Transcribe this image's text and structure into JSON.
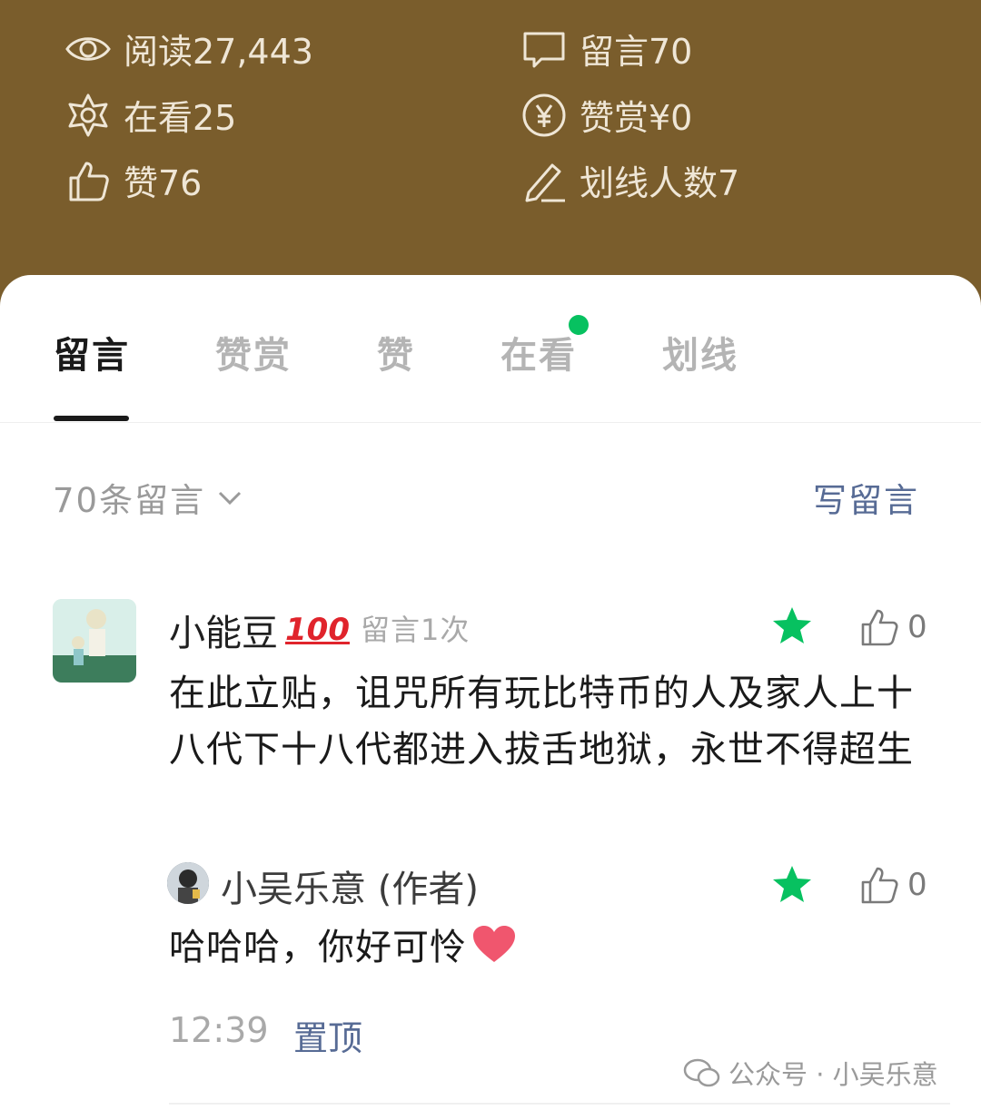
{
  "stats": {
    "reads": "阅读27,443",
    "comments": "留言70",
    "watching": "在看25",
    "rewards": "赞赏¥0",
    "likes": "赞76",
    "underline": "划线人数7"
  },
  "tabs": [
    {
      "label": "留言",
      "active": true
    },
    {
      "label": "赞赏",
      "active": false
    },
    {
      "label": "赞",
      "active": false
    },
    {
      "label": "在看",
      "active": false,
      "badge_dot": true
    },
    {
      "label": "划线",
      "active": false
    }
  ],
  "comments_header": {
    "count_label": "70条留言",
    "write_label": "写留言"
  },
  "comment": {
    "author": "小能豆",
    "author_emoji": "100",
    "meta": "留言1次",
    "like_count": "0",
    "text": "在此立贴，诅咒所有玩比特币的人及家人上十八代下十八代都进入拔舌地狱，永世不得超生",
    "reply": {
      "author": "小吴乐意 (作者)",
      "text": "哈哈哈，你好可怜",
      "like_count": "0"
    },
    "time": "12:39",
    "pin_label": "置顶"
  },
  "watermark": "公众号 · 小吴乐意",
  "colors": {
    "header_bg": "#7a5d2c",
    "accent_green": "#07c160",
    "link_blue": "#576b95"
  }
}
